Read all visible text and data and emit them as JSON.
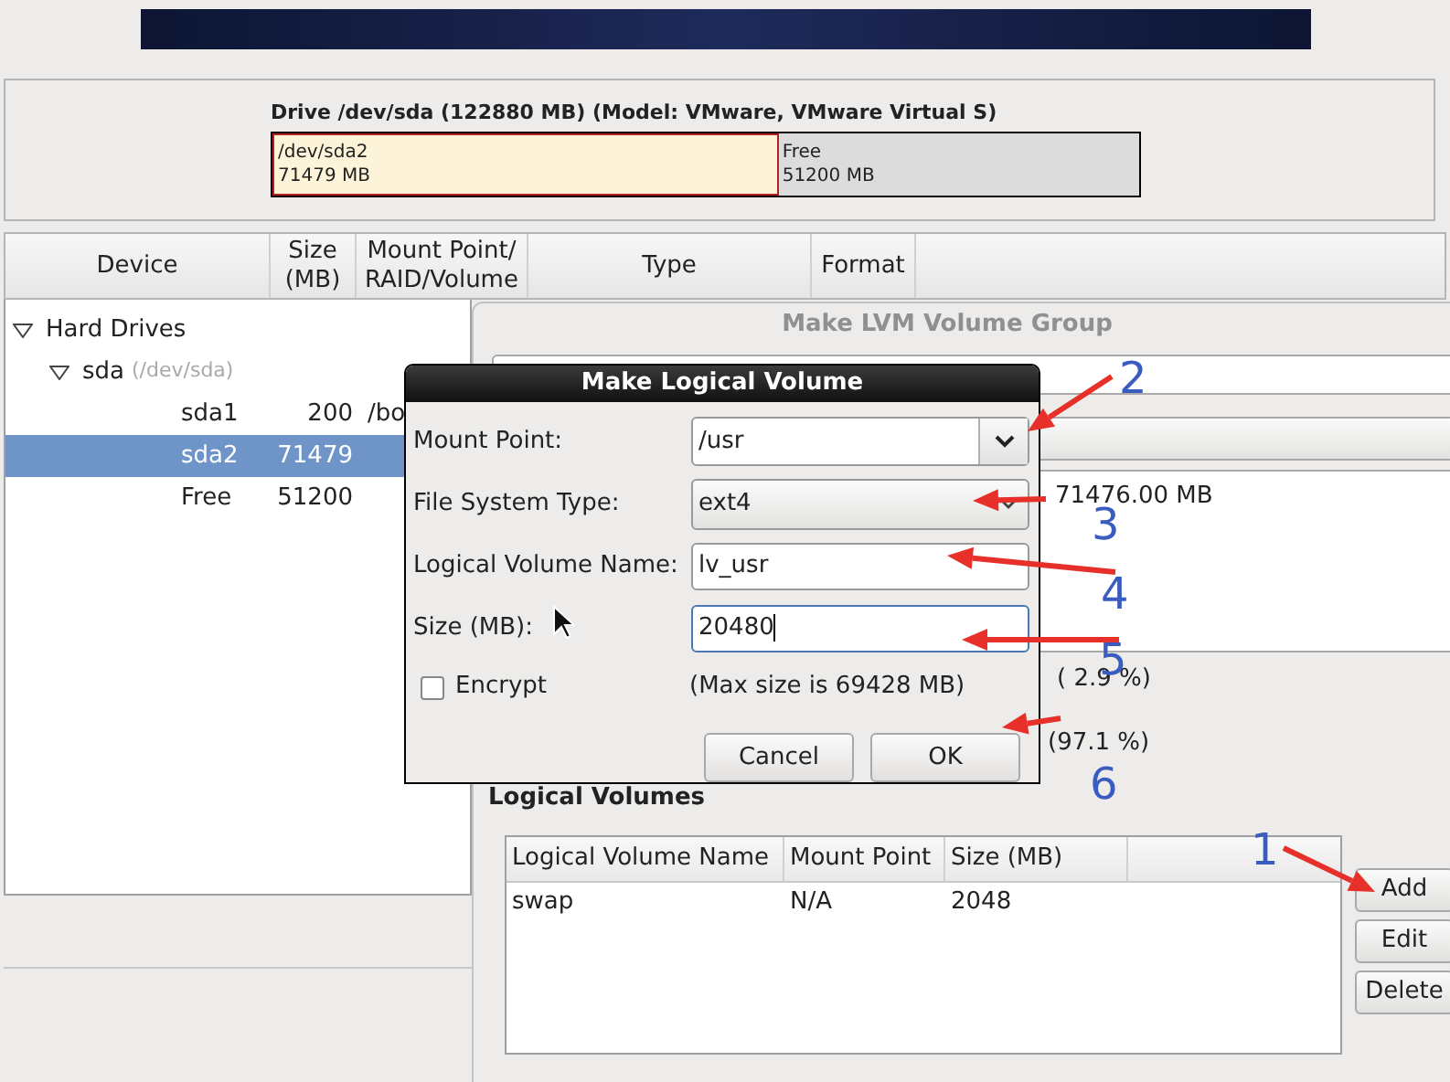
{
  "drive": {
    "title": "Drive /dev/sda (122880 MB) (Model: VMware, VMware Virtual S)",
    "segments": [
      {
        "label": "/dev/sda2",
        "size": "71479 MB",
        "selected": true
      },
      {
        "label": "Free",
        "size": "51200 MB",
        "selected": false
      }
    ]
  },
  "partition_table": {
    "columns": [
      [
        "Device"
      ],
      [
        "Size",
        "(MB)"
      ],
      [
        "Mount Point/",
        "RAID/Volume"
      ],
      [
        "Type"
      ],
      [
        "Format"
      ]
    ],
    "rows": [
      {
        "device": "Hard Drives",
        "expanded": true,
        "children": [
          {
            "device": "sda",
            "note": "(/dev/sda)",
            "expanded": true,
            "children": [
              {
                "device": "sda1",
                "size": "200",
                "mount": "/bo",
                "selected": false
              },
              {
                "device": "sda2",
                "size": "71479",
                "selected": true
              },
              {
                "device": "Free",
                "size": "51200",
                "selected": false
              }
            ]
          }
        ]
      }
    ]
  },
  "lvm_window": {
    "title": "Make LVM Volume Group",
    "pv_size": "71476.00 MB",
    "used_percent": "( 2.9 %)",
    "free_percent": "(97.1 %)",
    "section_title": "Logical Volumes",
    "lv_table": {
      "columns": [
        "Logical Volume Name",
        "Mount Point",
        "Size (MB)"
      ],
      "rows": [
        [
          "swap",
          "N/A",
          "2048"
        ]
      ]
    },
    "buttons": [
      "Add",
      "Edit",
      "Delete"
    ]
  },
  "dialog": {
    "title": "Make Logical Volume",
    "fields": [
      {
        "label": "Mount Point:",
        "kind": "combo",
        "value": "/usr",
        "focused": false
      },
      {
        "label": "File System Type:",
        "kind": "dropdown",
        "value": "ext4",
        "focused": false
      },
      {
        "label": "Logical Volume Name:",
        "kind": "text",
        "value": "lv_usr",
        "focused": false
      },
      {
        "label": "Size (MB):",
        "kind": "text",
        "value": "20480",
        "focused": true
      }
    ],
    "encrypt": {
      "label": "Encrypt",
      "checked": false
    },
    "max_size": "(Max size is 69428 MB)",
    "buttons": [
      "Cancel",
      "OK"
    ]
  },
  "annotations": [
    "1",
    "2",
    "3",
    "4",
    "5",
    "6"
  ]
}
